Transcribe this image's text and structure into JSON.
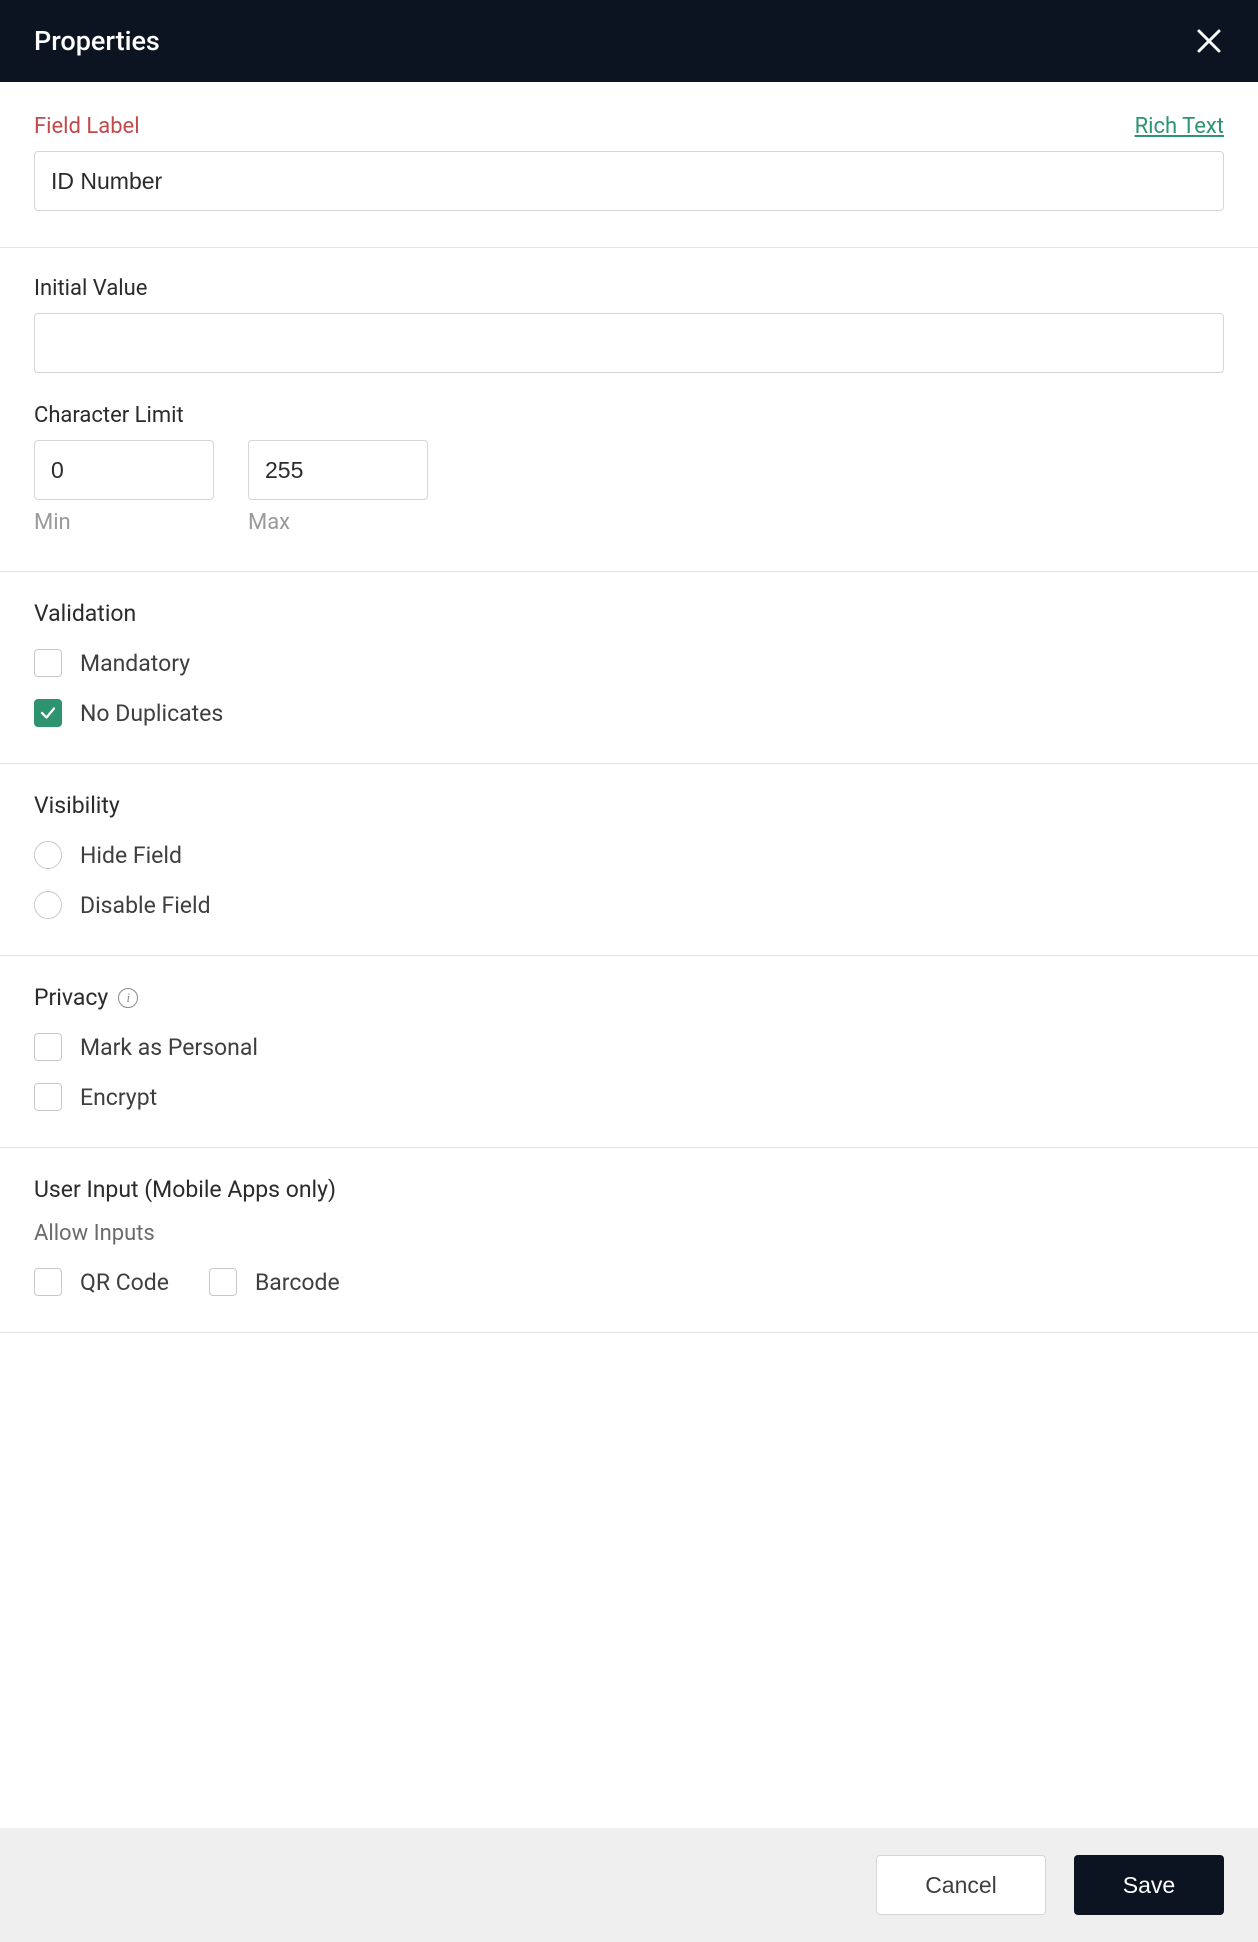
{
  "header": {
    "title": "Properties"
  },
  "field_label": {
    "label": "Field Label",
    "rich_text_link": "Rich Text",
    "value": "ID Number"
  },
  "initial_value": {
    "label": "Initial Value",
    "value": ""
  },
  "character_limit": {
    "label": "Character Limit",
    "min_value": "0",
    "min_hint": "Min",
    "max_value": "255",
    "max_hint": "Max"
  },
  "validation": {
    "title": "Validation",
    "mandatory_label": "Mandatory",
    "mandatory_checked": false,
    "no_duplicates_label": "No Duplicates",
    "no_duplicates_checked": true
  },
  "visibility": {
    "title": "Visibility",
    "hide_label": "Hide Field",
    "hide_selected": false,
    "disable_label": "Disable Field",
    "disable_selected": false
  },
  "privacy": {
    "title": "Privacy",
    "personal_label": "Mark as Personal",
    "personal_checked": false,
    "encrypt_label": "Encrypt",
    "encrypt_checked": false
  },
  "user_input": {
    "title": "User Input (Mobile Apps only)",
    "subtitle": "Allow Inputs",
    "qr_label": "QR Code",
    "qr_checked": false,
    "barcode_label": "Barcode",
    "barcode_checked": false
  },
  "footer": {
    "cancel": "Cancel",
    "save": "Save"
  }
}
